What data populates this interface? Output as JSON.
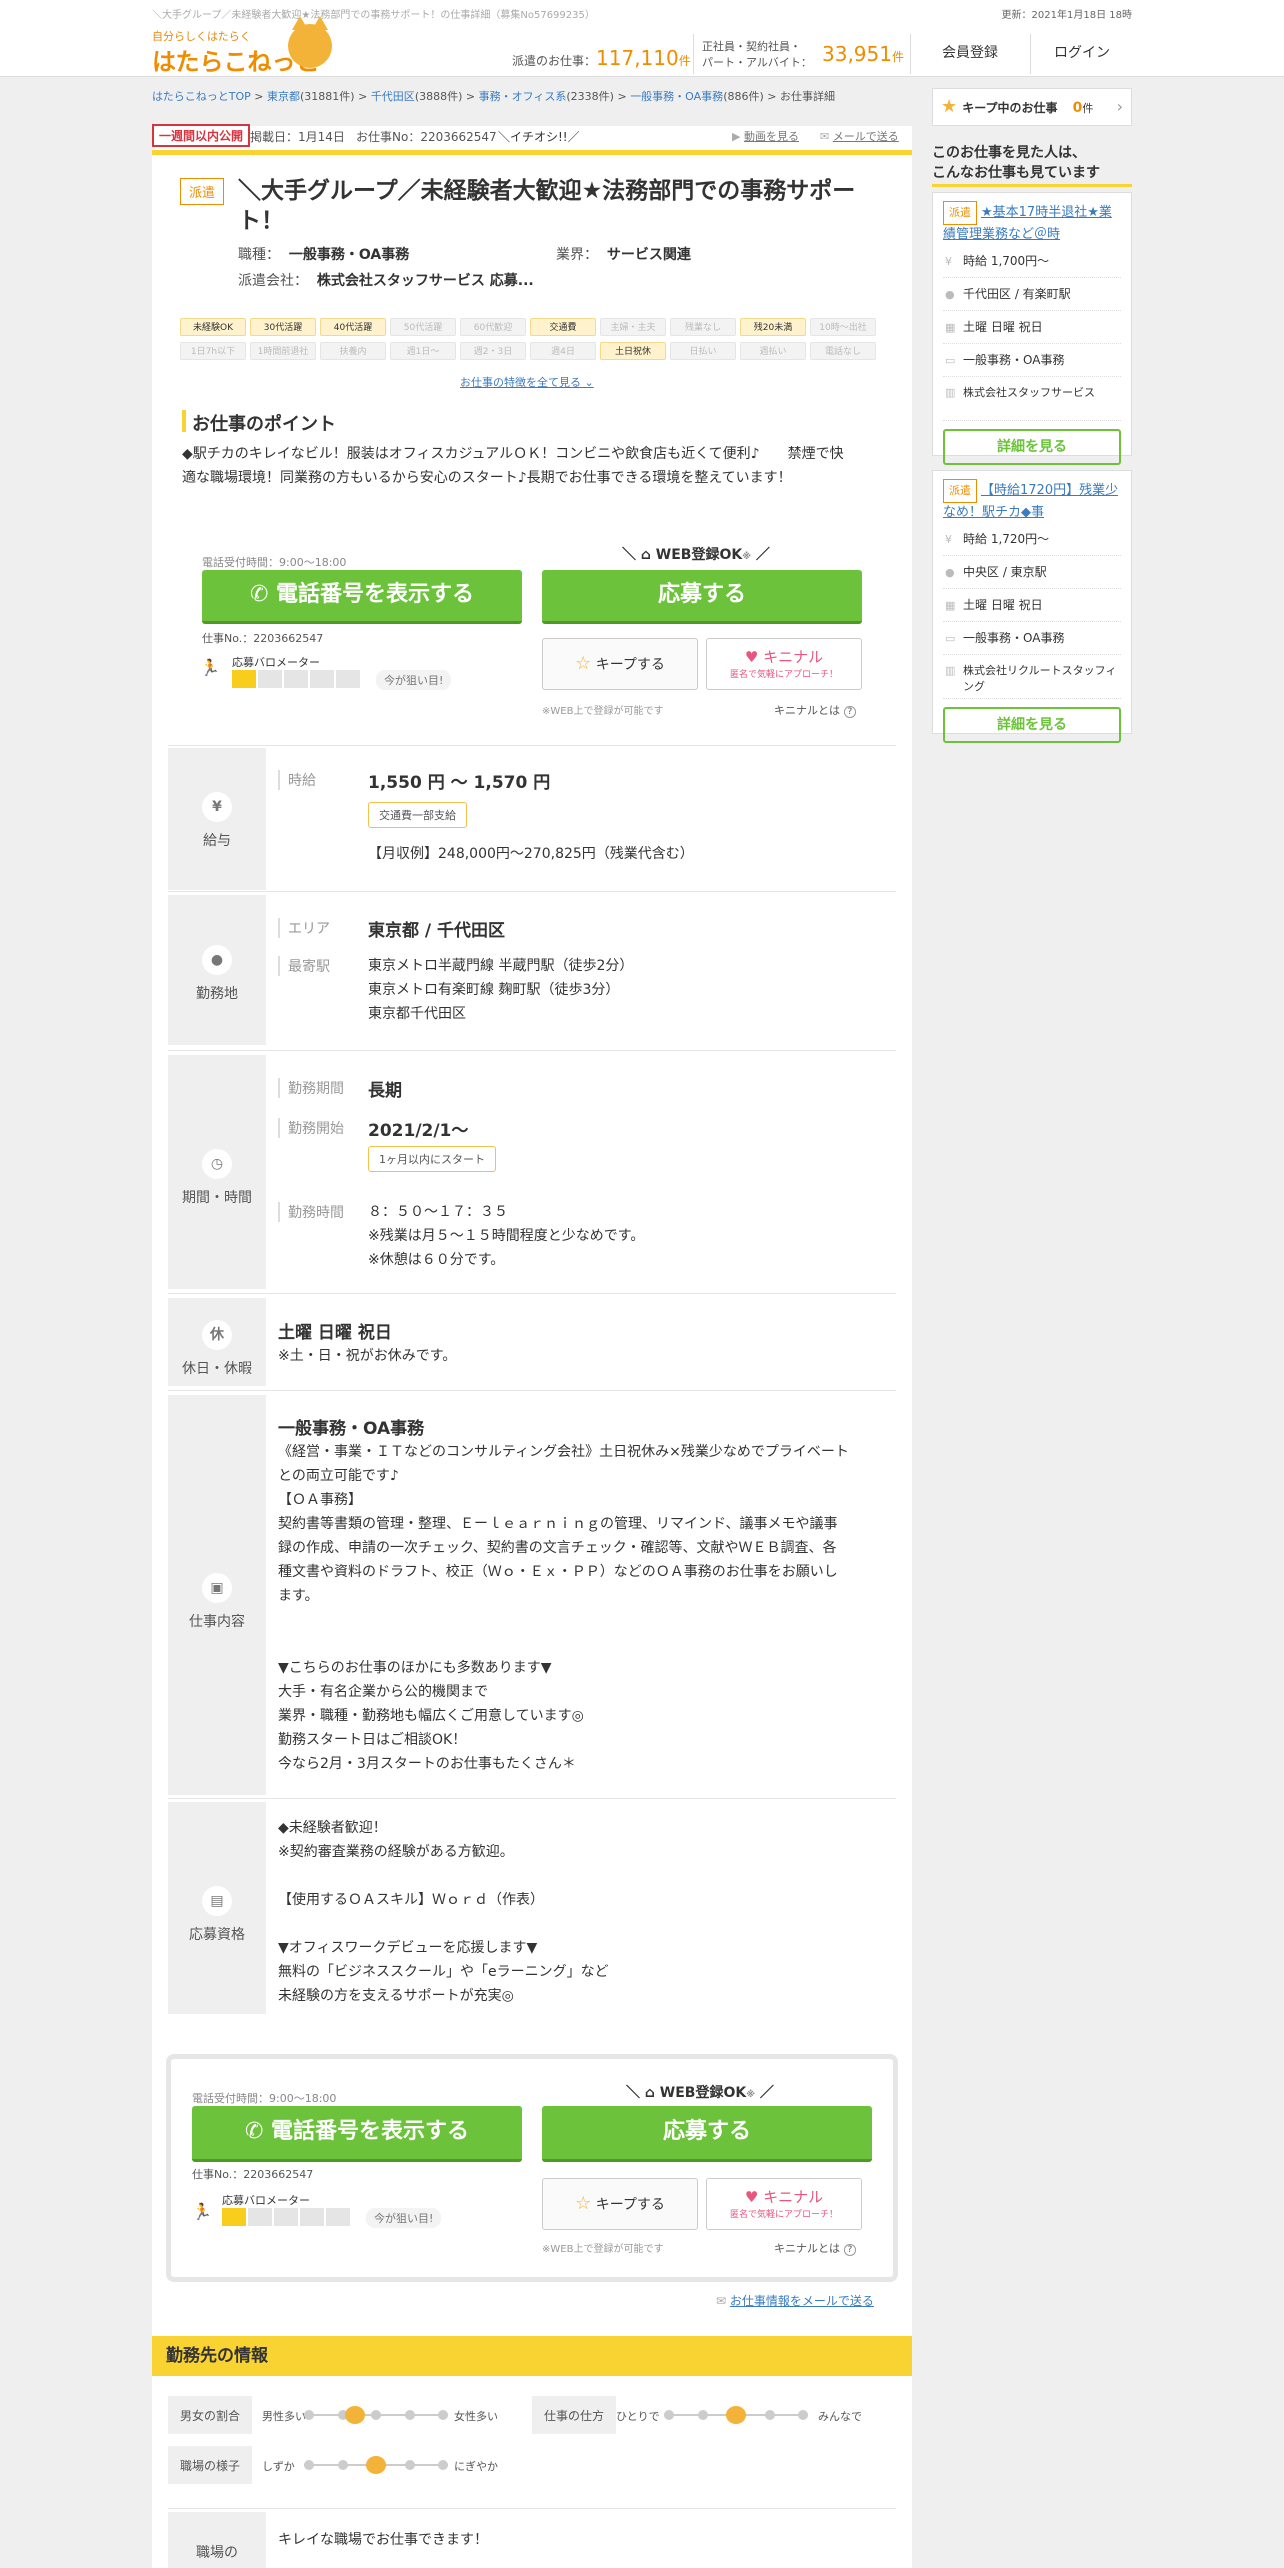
{
  "top": {
    "breadcrumb_title": "＼大手グループ／未経験者大歓迎★法務部門での事務サポート！の仕事詳細（募集No57699235）",
    "updated": "更新：2021年1月18日 18時"
  },
  "logo": {
    "tagline": "自分らしくはたらく",
    "name": "はたらこねっと"
  },
  "counts": {
    "haken_label": "派遣のお仕事：",
    "haken_num": "117,110",
    "unit": "件",
    "other_label1": "正社員・契約社員・",
    "other_label2": "パート・アルバイト：",
    "other_num": "33,951"
  },
  "nav": {
    "register": "会員登録",
    "login": "ログイン"
  },
  "breadcrumb": [
    {
      "text": "はたらこねっとTOP",
      "link": true
    },
    {
      "text": " > ",
      "link": false
    },
    {
      "text": "東京都",
      "link": true
    },
    {
      "text": "(31881件) > ",
      "link": false
    },
    {
      "text": "千代田区",
      "link": true
    },
    {
      "text": "(3888件) > ",
      "link": false
    },
    {
      "text": "事務・オフィス系",
      "link": true
    },
    {
      "text": "(2338件) > ",
      "link": false
    },
    {
      "text": "一般事務・OA事務",
      "link": true
    },
    {
      "text": "(886件) > お仕事詳細",
      "link": false
    }
  ],
  "meta": {
    "badge": "一週間以内公開",
    "posted": "掲載日：1月14日",
    "job_no": "お仕事No：2203662547",
    "ikete": "＼イチオシ!!／",
    "video": "動画を見る",
    "mail": "メールで送る"
  },
  "job": {
    "type_tag": "派遣",
    "title": "＼大手グループ／未経験者大歓迎★法務部門での事務サポート！",
    "occupation_label": "職種：",
    "occupation": "一般事務・OA事務",
    "industry_label": "業界：",
    "industry": "サービス関連",
    "company_label": "派遣会社：",
    "company": "株式会社スタッフサービス 応募..."
  },
  "tags": [
    {
      "text": "未経験OK",
      "on": true
    },
    {
      "text": "30代活躍",
      "on": true
    },
    {
      "text": "40代活躍",
      "on": true
    },
    {
      "text": "50代活躍",
      "on": false
    },
    {
      "text": "60代歓迎",
      "on": false
    },
    {
      "text": "交通費",
      "on": true
    },
    {
      "text": "主婦・主夫",
      "on": false
    },
    {
      "text": "残業なし",
      "on": false
    },
    {
      "text": "残20未満",
      "on": true
    },
    {
      "text": "10時～出社",
      "on": false
    },
    {
      "text": "1日7h以下",
      "on": false
    },
    {
      "text": "1時間前退社",
      "on": false
    },
    {
      "text": "扶養内",
      "on": false
    },
    {
      "text": "週1日～",
      "on": false
    },
    {
      "text": "週2・3日",
      "on": false
    },
    {
      "text": "週4日",
      "on": false
    },
    {
      "text": "土日祝休",
      "on": true
    },
    {
      "text": "日払い",
      "on": false
    },
    {
      "text": "週払い",
      "on": false
    },
    {
      "text": "電話なし",
      "on": false
    }
  ],
  "tags_more": "お仕事の特徴を全て見る ⌄",
  "point": {
    "heading": "お仕事のポイント",
    "text": "◆駅チカのキレイなビル！服装はオフィスカジュアルＯＫ！コンビニや飲食店も近くて便利♪　　禁煙で快適な職場環境！同業務の方もいるから安心のスタート♪長期でお仕事できる環境を整えています！"
  },
  "apply": {
    "phone_hours": "電話受付時間：9:00～18:00",
    "phone_btn": "電話番号を表示する",
    "web_ok": "WEB登録OK",
    "web_ok_mark": "※",
    "apply_btn": "応募する",
    "job_no": "仕事No.：2203662547",
    "meter_label": "応募バロメーター",
    "meter_level": 1,
    "meter_max": 5,
    "meter_hint": "今が狙い目!",
    "keep_btn": "キープする",
    "kininal_btn": "キニナル",
    "kininal_sub": "匿名で気軽にアプローチ！",
    "web_note": "※WEB上で登録が可能です",
    "kininal_about": "キニナルとは"
  },
  "salary": {
    "section": "給与",
    "icon": "¥",
    "label": "時給",
    "value": "1,550 円 ～ 1,570 円",
    "badge": "交通費一部支給",
    "example": "【月収例】248,000円～270,825円（残業代含む）"
  },
  "location": {
    "section": "勤務地",
    "area_label": "エリア",
    "area": "東京都 / 千代田区",
    "station_label": "最寄駅",
    "stations": [
      "東京メトロ半蔵門線 半蔵門駅（徒歩2分）",
      "東京メトロ有楽町線 麹町駅（徒歩3分）",
      "東京都千代田区"
    ]
  },
  "period": {
    "section": "期間・時間",
    "term_label": "勤務期間",
    "term": "長期",
    "start_label": "勤務開始",
    "start": "2021/2/1～",
    "start_badge": "1ヶ月以内にスタート",
    "hours_label": "勤務時間",
    "hours": [
      "８：５０～１７：３５",
      "※残業は月５～１５時間程度と少なめです。",
      "※休憩は６０分です。"
    ]
  },
  "holiday": {
    "section": "休日・休暇",
    "icon": "休",
    "value": "土曜 日曜 祝日",
    "note": "※土・日・祝がお休みです。"
  },
  "content": {
    "section": "仕事内容",
    "title": "一般事務・OA事務",
    "lines": [
      "《経営・事業・ＩＴなどのコンサルティング会社》土日祝休み×残業少なめでプライベート",
      "との両立可能です♪",
      "【ＯＡ事務】",
      "契約書等書類の管理・整理、Ｅーｌｅａｒｎｉｎｇの管理、リマインド、議事メモや議事",
      "録の作成、申請の一次チェック、契約書の文言チェック・確認等、文献やＷＥＢ調査、各",
      "種文書や資料のドラフト、校正（Ｗｏ・Ｅｘ・ＰＰ）などのＯＡ事務のお仕事をお願いし",
      "ます。",
      "",
      "",
      "▼こちらのお仕事のほかにも多数あります▼",
      "大手・有名企業から公的機関まで",
      "業界・職種・勤務地も幅広くご用意しています◎",
      "勤務スタート日はご相談OK！",
      "今なら2月・3月スタートのお仕事もたくさん＊"
    ]
  },
  "qualification": {
    "section": "応募資格",
    "lines": [
      "◆未経験者歓迎！",
      "※契約審査業務の経験がある方歓迎。",
      "",
      "【使用するＯＡスキル】Ｗｏｒｄ（作表）",
      "",
      "▼オフィスワークデビューを応援します▼",
      "無料の「ビジネススクール」や「eラーニング」など",
      "未経験の方を支えるサポートが充実◎"
    ]
  },
  "mail_link": "お仕事情報をメールで送る",
  "workplace": {
    "heading": "勤務先の情報",
    "gender_label": "男女の割合",
    "gender_left": "男性多い",
    "gender_right": "女性多い",
    "gender_pos": 0.33,
    "style_label": "仕事の仕方",
    "style_left": "ひとりで",
    "style_right": "みんなで",
    "style_pos": 0.5,
    "mood_label": "職場の様子",
    "mood_left": "しずか",
    "mood_right": "にぎやか",
    "mood_pos": 0.5,
    "env_label": "職場の",
    "env_text": "キレイな職場でお仕事できます！"
  },
  "sidebar": {
    "keep_label": "キープ中のお仕事",
    "keep_count": "0",
    "keep_unit": "件",
    "also_title1": "このお仕事を見た人は、",
    "also_title2": "こんなお仕事も見ています",
    "cards": [
      {
        "tag": "派遣",
        "title": "★基本17時半退社★業績管理業務など＠時",
        "wage": "時給 1,700円～",
        "place": "千代田区 / 有楽町駅",
        "holiday": "土曜 日曜 祝日",
        "job": "一般事務・OA事務",
        "company": "株式会社スタッフサービス",
        "btn": "詳細を見る"
      },
      {
        "tag": "派遣",
        "title": "【時給1720円】残業少なめ！駅チカ◆事",
        "wage": "時給 1,720円～",
        "place": "中央区 / 東京駅",
        "holiday": "土曜 日曜 祝日",
        "job": "一般事務・OA事務",
        "company": "株式会社リクルートスタッフィング",
        "btn": "詳細を見る"
      }
    ]
  },
  "colors": {
    "accent": "#f08c00",
    "green": "#6cc33b",
    "yellow": "#f9d331",
    "link": "#3a7cc1"
  }
}
